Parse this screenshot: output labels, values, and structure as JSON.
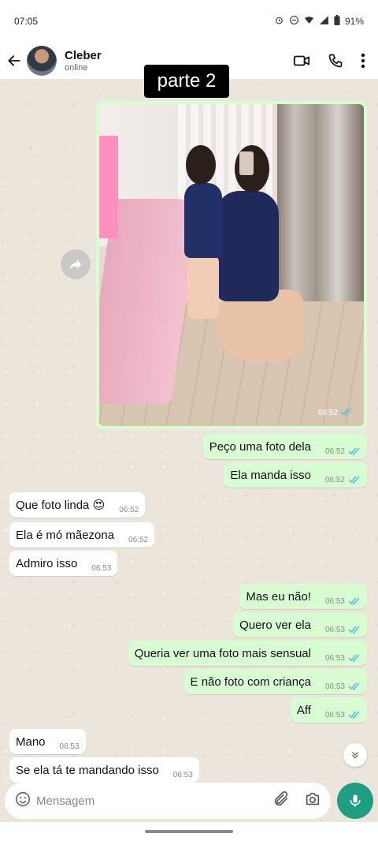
{
  "status_bar": {
    "time": "07:05",
    "battery": "91%"
  },
  "header": {
    "contact_name": "Cleber",
    "contact_status": "online"
  },
  "caption": "parte 2",
  "photo_message": {
    "time": "06:52",
    "read": true
  },
  "messages": [
    {
      "dir": "out",
      "text": "Peço uma foto dela",
      "time": "06:52"
    },
    {
      "dir": "out",
      "text": "Ela manda isso",
      "time": "06:52"
    },
    {
      "dir": "in",
      "text": "Que foto linda 😍",
      "time": "06:52"
    },
    {
      "dir": "in",
      "text": "Ela é mó mãezona",
      "time": "06:52"
    },
    {
      "dir": "in",
      "text": "Admiro isso",
      "time": "06:53"
    },
    {
      "dir": "out",
      "text": "Mas eu não!",
      "time": "06:53"
    },
    {
      "dir": "out",
      "text": "Quero ver ela",
      "time": "06:53"
    },
    {
      "dir": "out",
      "text": "Queria ver uma foto mais sensual",
      "time": "06:53"
    },
    {
      "dir": "out",
      "text": "E não foto com criança",
      "time": "06:53"
    },
    {
      "dir": "out",
      "text": "Aff",
      "time": "06:53"
    },
    {
      "dir": "in",
      "text": "Mano",
      "time": "06:53"
    },
    {
      "dir": "in",
      "text": "Se ela tá te mandando isso",
      "time": "06:53"
    }
  ],
  "input": {
    "placeholder": "Mensagem"
  },
  "colors": {
    "outgoing_bubble": "#d9fdd3",
    "incoming_bubble": "#ffffff",
    "chat_background": "#ece5dc",
    "accent": "#1f9e84",
    "read_ticks": "#53bdeb"
  },
  "icons": {
    "back": "back-arrow-icon",
    "video": "video-call-icon",
    "call": "phone-icon",
    "menu": "more-vert-icon",
    "forward": "forward-icon",
    "emoji": "emoji-icon",
    "attach": "paperclip-icon",
    "camera": "camera-icon",
    "mic": "microphone-icon",
    "scroll": "chevron-double-down-icon"
  }
}
